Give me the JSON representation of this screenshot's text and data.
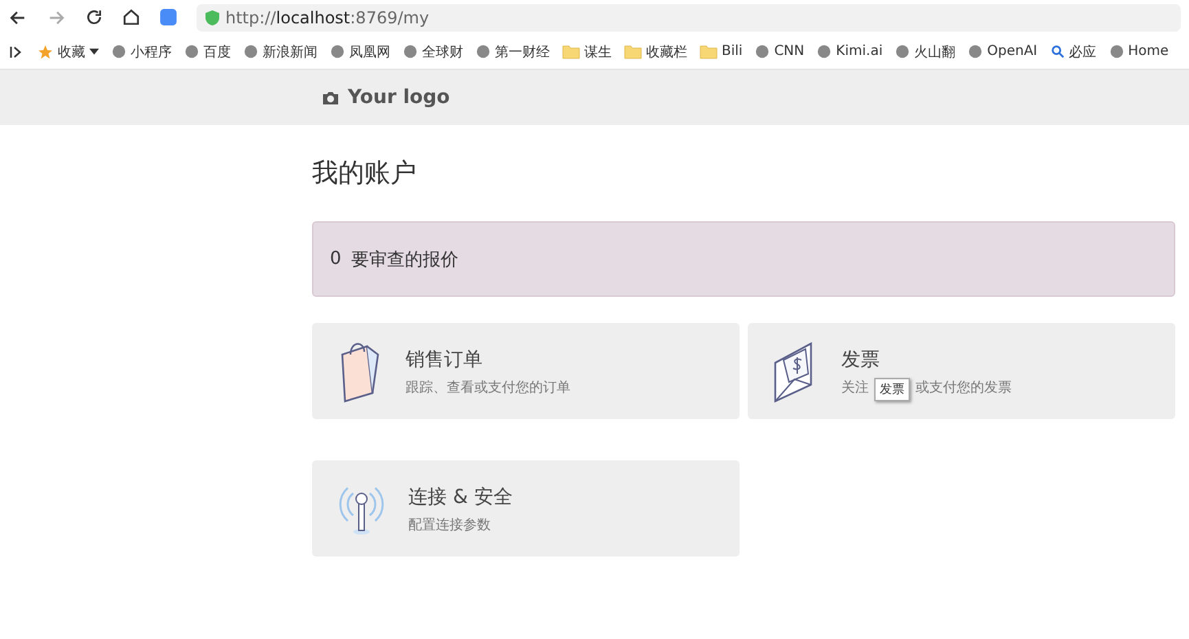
{
  "browser": {
    "url_scheme": "http://",
    "url_host": "localhost",
    "url_rest": ":8769/my"
  },
  "bookmarks": [
    {
      "kind": "favorite",
      "label": "收藏"
    },
    {
      "kind": "site",
      "label": "小程序"
    },
    {
      "kind": "site",
      "label": "百度"
    },
    {
      "kind": "site",
      "label": "新浪新闻"
    },
    {
      "kind": "site",
      "label": "凤凰网"
    },
    {
      "kind": "site",
      "label": "全球财"
    },
    {
      "kind": "site",
      "label": "第一财经"
    },
    {
      "kind": "folder",
      "label": "谋生"
    },
    {
      "kind": "folder",
      "label": "收藏栏"
    },
    {
      "kind": "folder",
      "label": "Bili"
    },
    {
      "kind": "site",
      "label": "CNN"
    },
    {
      "kind": "site",
      "label": "Kimi.ai"
    },
    {
      "kind": "site",
      "label": "火山翻"
    },
    {
      "kind": "site",
      "label": "OpenAI"
    },
    {
      "kind": "search",
      "label": "必应"
    },
    {
      "kind": "site",
      "label": "Home"
    }
  ],
  "header": {
    "logo": "Your logo"
  },
  "page_title": "我的账户",
  "alert": {
    "count": "0",
    "text": "要审查的报价"
  },
  "cards": [
    {
      "kind": "bag",
      "title": "销售订单",
      "description": "跟踪、查看或支付您的订单"
    },
    {
      "kind": "envelope",
      "title": "发票",
      "description": "关注",
      "description_tail": "或支付您的发票",
      "tooltip": "发票"
    },
    {
      "kind": "antenna",
      "title": "连接 & 安全",
      "description": "配置连接参数"
    }
  ]
}
